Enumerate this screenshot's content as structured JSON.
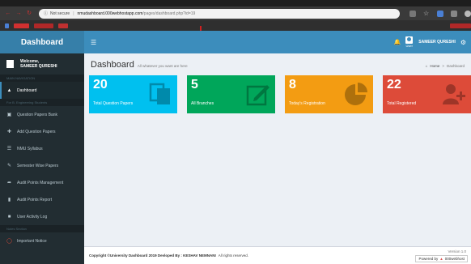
{
  "browser": {
    "not_secure": "Not secure",
    "host": "nmudashboard.000webhostapp.com",
    "path": "/pages/dashboard.php?id=19"
  },
  "app": {
    "logo": "Dashboard",
    "user_role": "User",
    "user_name": "SAMEER QURESHI"
  },
  "sidebar": {
    "welcome": "Welcome,",
    "user": "SAMEER QURESHI",
    "header_main": "MAIN NAVIGATION",
    "header_eng": "For B. Engineering Students",
    "header_notes": "Notes Section",
    "items": [
      {
        "label": "Dashboard",
        "icon": "dashboard-icon"
      },
      {
        "label": "Question Papers Bank",
        "icon": "bank-icon"
      },
      {
        "label": "Add Question Papers",
        "icon": "plus-icon"
      },
      {
        "label": "NMU Syllabus",
        "icon": "book-icon"
      },
      {
        "label": "Semester Wise Papers",
        "icon": "edit-icon"
      },
      {
        "label": "Audit Points Management",
        "icon": "reply-icon"
      },
      {
        "label": "Audit Points Report",
        "icon": "file-icon"
      },
      {
        "label": "User Activity Log",
        "icon": "folder-icon"
      },
      {
        "label": "Important Notice",
        "icon": "circle-icon"
      }
    ]
  },
  "content": {
    "title": "Dashboard",
    "subtitle": "All whatever you want are here",
    "breadcrumb_home": "Home",
    "breadcrumb_current": "Dashboard"
  },
  "boxes": [
    {
      "number": "20",
      "label": "Total Question Papers",
      "icon": "copy-icon",
      "color": "#00c0ef"
    },
    {
      "number": "5",
      "label": "All Branches",
      "icon": "pencil-square-icon",
      "color": "#00a65a"
    },
    {
      "number": "8",
      "label": "Today's Registration",
      "icon": "pie-chart-icon",
      "color": "#f39c12"
    },
    {
      "number": "22",
      "label": "Total Registered",
      "icon": "user-plus-icon",
      "color": "#dd4b39"
    }
  ],
  "footer": {
    "prefix": "Copyright ©University Dashboard 2019 Devloped By : KESHAV NEMNANI",
    "suffix": "All rights reserved.",
    "version": "Version 1.0",
    "powered": "Powered by",
    "brand": "000webhost"
  }
}
